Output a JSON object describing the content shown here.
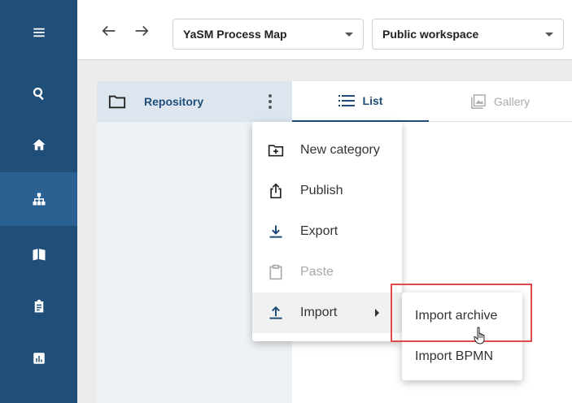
{
  "sidebar": {
    "items": [
      {
        "icon": "menu-icon"
      },
      {
        "icon": "search-icon"
      },
      {
        "icon": "home-icon"
      },
      {
        "icon": "process-map-icon",
        "active": true
      },
      {
        "icon": "book-icon"
      },
      {
        "icon": "clipboard-icon"
      },
      {
        "icon": "report-chart-icon"
      }
    ]
  },
  "topbar": {
    "map_select": "YaSM Process Map",
    "workspace_select": "Public workspace"
  },
  "repository": {
    "label": "Repository"
  },
  "tabs": [
    {
      "label": "List",
      "active": true
    },
    {
      "label": "Gallery",
      "active": false
    }
  ],
  "context_menu": {
    "items": [
      {
        "label": "New category",
        "icon": "new-folder-icon"
      },
      {
        "label": "Publish",
        "icon": "publish-icon"
      },
      {
        "label": "Export",
        "icon": "export-icon"
      },
      {
        "label": "Paste",
        "icon": "paste-icon",
        "disabled": true
      },
      {
        "label": "Import",
        "icon": "import-icon",
        "has_submenu": true
      }
    ]
  },
  "import_submenu": {
    "items": [
      {
        "label": "Import archive"
      },
      {
        "label": "Import BPMN"
      }
    ]
  },
  "colors": {
    "sidebar": "#1f4e79",
    "accent": "#1f4e79",
    "highlight": "#e04a4a"
  }
}
